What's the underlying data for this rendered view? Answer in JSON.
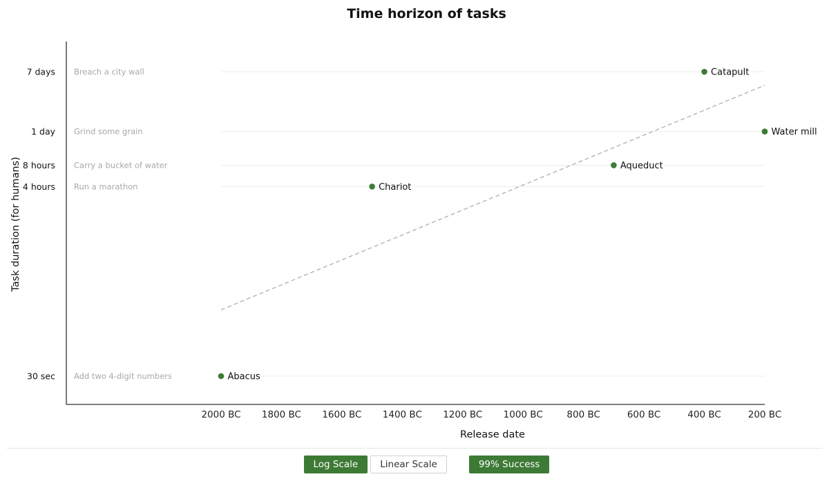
{
  "controls": {
    "log_label": "Log Scale",
    "linear_label": "Linear Scale",
    "success_label": "99% Success",
    "active_scale": "log"
  },
  "colors": {
    "point": "#3d7a35",
    "trend": "#b3b3b3",
    "grid": "#ececec",
    "axis": "#333333"
  },
  "chart_data": {
    "type": "scatter",
    "title": "Time horizon of tasks",
    "xlabel": "Release date",
    "ylabel": "Task duration (for humans)",
    "yscale": "log",
    "grid": "horizontal lines at task levels",
    "x_ticks": [
      {
        "value": -2000,
        "label": "2000 BC"
      },
      {
        "value": -1800,
        "label": "1800 BC"
      },
      {
        "value": -1600,
        "label": "1600 BC"
      },
      {
        "value": -1400,
        "label": "1400 BC"
      },
      {
        "value": -1200,
        "label": "1200 BC"
      },
      {
        "value": -1000,
        "label": "1000 BC"
      },
      {
        "value": -800,
        "label": "800 BC"
      },
      {
        "value": -600,
        "label": "600 BC"
      },
      {
        "value": -400,
        "label": "400 BC"
      },
      {
        "value": -200,
        "label": "200 BC"
      }
    ],
    "y_ticks": [
      {
        "seconds": 30,
        "label": "30 sec",
        "task": "Add two 4-digit numbers"
      },
      {
        "seconds": 14400,
        "label": "4 hours",
        "task": "Run a marathon"
      },
      {
        "seconds": 28800,
        "label": "8 hours",
        "task": "Carry a bucket of water"
      },
      {
        "seconds": 86400,
        "label": "1 day",
        "task": "Grind some grain"
      },
      {
        "seconds": 604800,
        "label": "7 days",
        "task": "Breach a city wall"
      }
    ],
    "points": [
      {
        "name": "Abacus",
        "x": -2000,
        "y": 30
      },
      {
        "name": "Chariot",
        "x": -1500,
        "y": 14400
      },
      {
        "name": "Aqueduct",
        "x": -700,
        "y": 28800
      },
      {
        "name": "Catapult",
        "x": -400,
        "y": 604800
      },
      {
        "name": "Water mill",
        "x": -200,
        "y": 86400
      }
    ],
    "trendline": [
      {
        "x": -2000,
        "y": 260
      },
      {
        "x": -200,
        "y": 390000
      }
    ]
  }
}
